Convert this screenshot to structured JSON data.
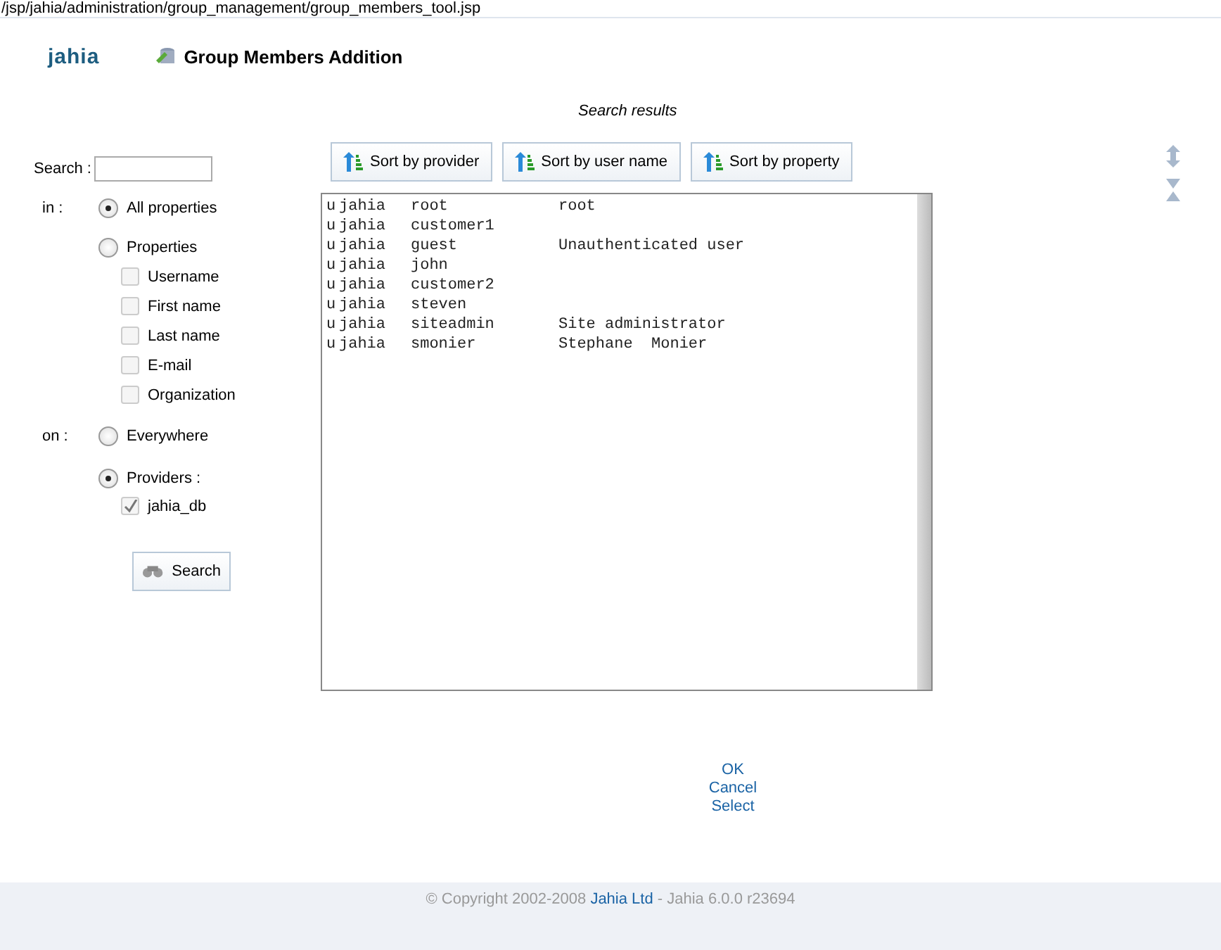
{
  "path": "/jsp/jahia/administration/group_management/group_members_tool.jsp",
  "logo": "jahia",
  "title": "Group Members Addition",
  "search": {
    "label": "Search :",
    "in_label": "in :",
    "on_label": "on :",
    "in_options": [
      {
        "label": "All properties",
        "selected": true
      },
      {
        "label": "Properties",
        "selected": false
      }
    ],
    "property_fields": [
      {
        "label": "Username",
        "checked": false
      },
      {
        "label": "First name",
        "checked": false
      },
      {
        "label": "Last name",
        "checked": false
      },
      {
        "label": "E-mail",
        "checked": false
      },
      {
        "label": "Organization",
        "checked": false
      }
    ],
    "on_options": [
      {
        "label": "Everywhere",
        "selected": false
      },
      {
        "label": "Providers :",
        "selected": true
      }
    ],
    "providers": [
      {
        "label": "jahia_db",
        "checked": true
      }
    ],
    "button": "Search"
  },
  "results_title": "Search results",
  "sort_buttons": [
    "Sort by provider",
    "Sort by user name",
    "Sort by property"
  ],
  "results": [
    {
      "type": "u",
      "provider": "jahia",
      "name": "root",
      "property": "root"
    },
    {
      "type": "u",
      "provider": "jahia",
      "name": "customer1"
    },
    {
      "type": "u",
      "provider": "jahia",
      "name": "guest",
      "property": "Unauthenticated user"
    },
    {
      "type": "u",
      "provider": "jahia",
      "name": "john"
    },
    {
      "type": "u",
      "provider": "jahia",
      "name": "customer2"
    },
    {
      "type": "u",
      "provider": "jahia",
      "name": "steven"
    },
    {
      "type": "u",
      "provider": "jahia",
      "name": "siteadmin",
      "property": "Site administrator"
    },
    {
      "type": "u",
      "provider": "jahia",
      "name": "smonier",
      "property": "Stephane  Monier"
    }
  ],
  "actions": [
    "OK",
    "Cancel",
    "Select"
  ],
  "footer": {
    "copyright": "© Copyright 2002-2008",
    "company": "Jahia Ltd",
    "version": "- Jahia 6.0.0 r23694"
  }
}
